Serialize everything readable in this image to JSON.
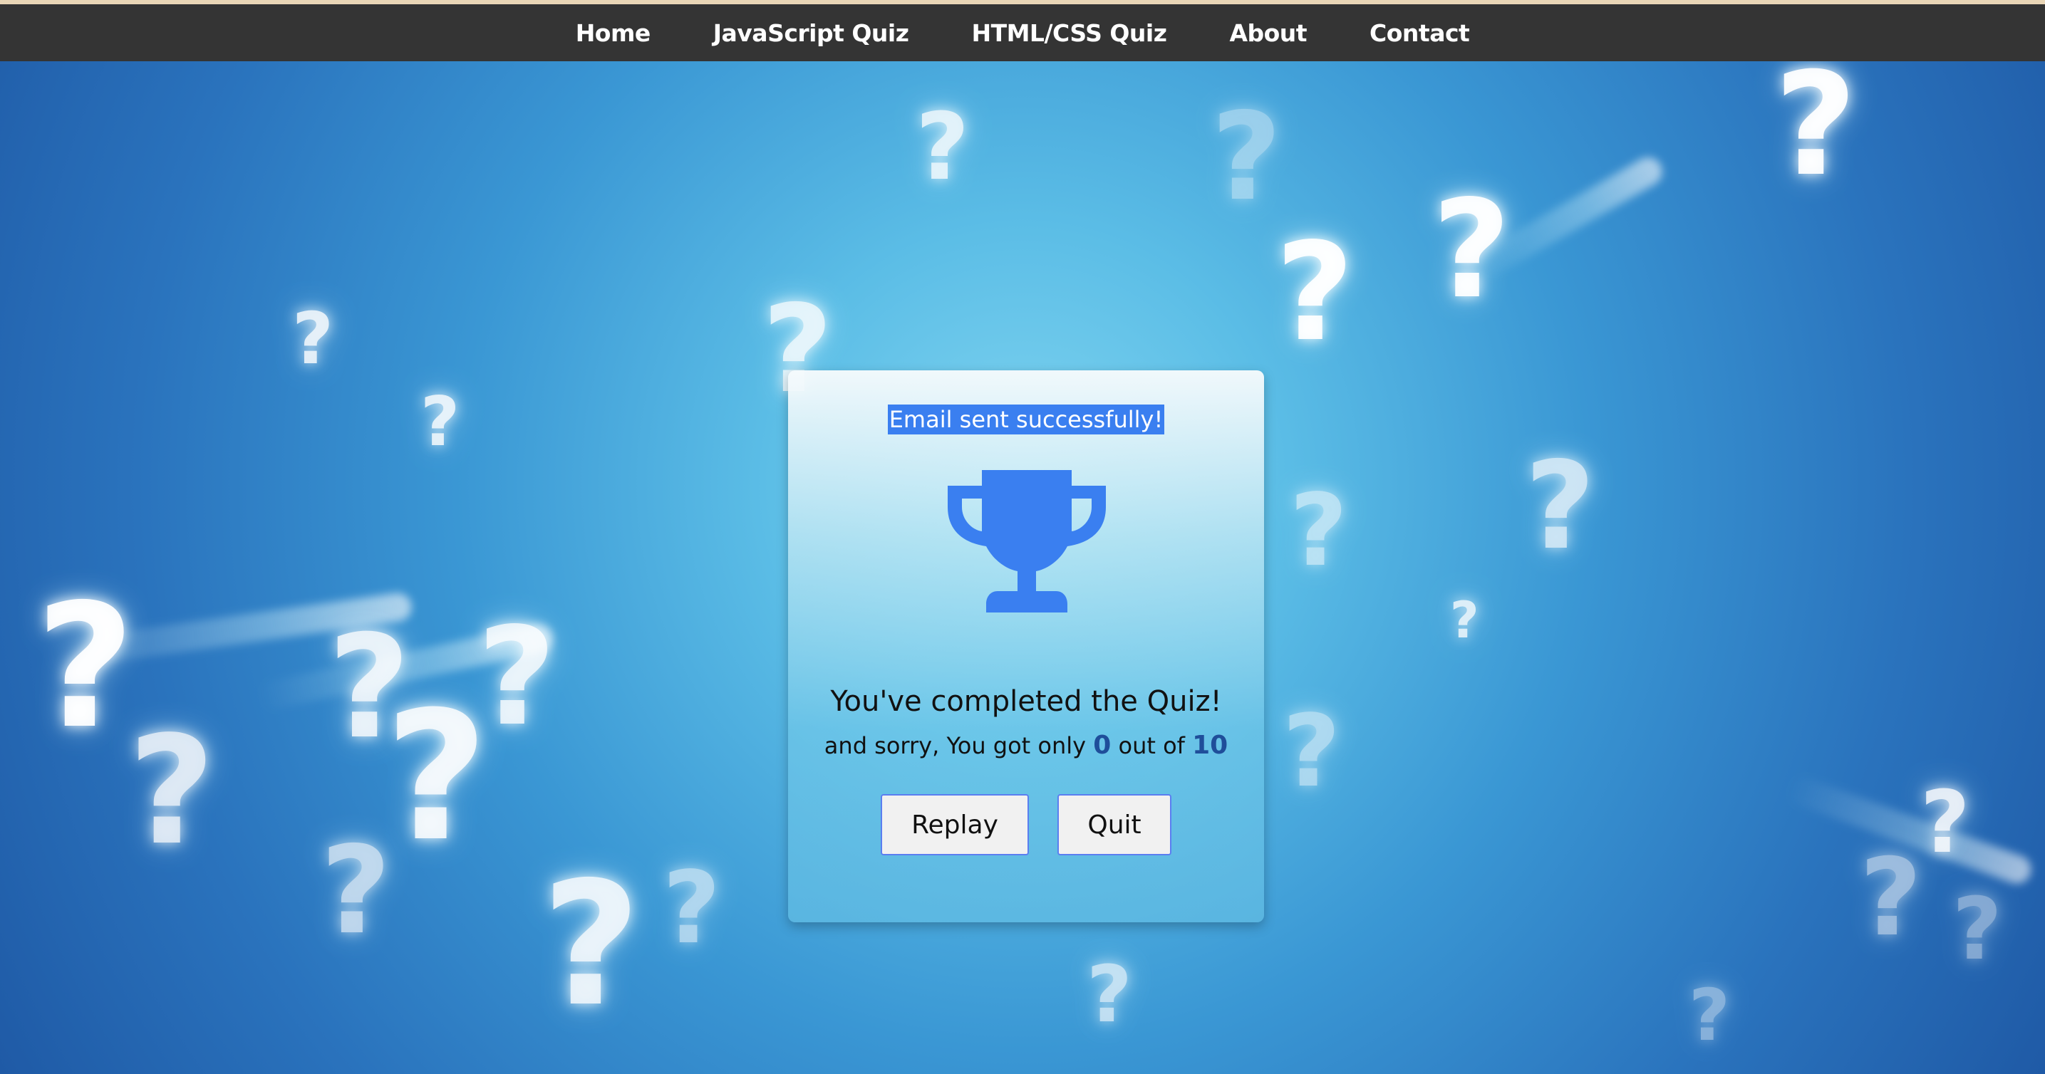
{
  "nav": {
    "items": [
      {
        "label": "Home"
      },
      {
        "label": "JavaScript Quiz"
      },
      {
        "label": "HTML/CSS Quiz"
      },
      {
        "label": "About"
      },
      {
        "label": "Contact"
      }
    ]
  },
  "result": {
    "email_message": "Email sent successfully!",
    "icon": "trophy-icon",
    "heading": "You've completed the Quiz!",
    "score_prefix": "and sorry, You got only",
    "score": "0",
    "score_middle": "out of",
    "total": "10"
  },
  "buttons": {
    "replay_label": "Replay",
    "quit_label": "Quit"
  },
  "colors": {
    "navbar": "#343434",
    "accent": "#3a7ff0",
    "score": "#1f4e9a"
  }
}
